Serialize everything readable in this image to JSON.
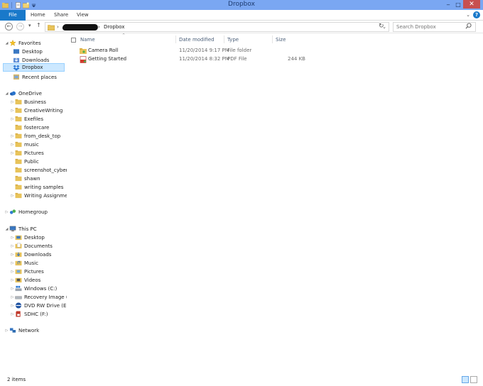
{
  "window": {
    "title": "Dropbox"
  },
  "ribbon": {
    "tabs": [
      "File",
      "Home",
      "Share",
      "View"
    ]
  },
  "address": {
    "current": "Dropbox"
  },
  "search": {
    "placeholder": "Search Dropbox"
  },
  "columns": {
    "name": "Name",
    "date": "Date modified",
    "type": "Type",
    "size": "Size"
  },
  "files": [
    {
      "name": "Camera Roll",
      "date": "11/20/2014 9:17 PM",
      "type": "File folder",
      "size": "",
      "icon": "folder-icon"
    },
    {
      "name": "Getting Started",
      "date": "11/20/2014 8:32 PM",
      "type": "PDF File",
      "size": "244 KB",
      "icon": "pdf-icon"
    }
  ],
  "nav": {
    "favorites": {
      "label": "Favorites",
      "items": [
        "Desktop",
        "Downloads",
        "Dropbox",
        "Recent places"
      ]
    },
    "onedrive": {
      "label": "OneDrive",
      "items": [
        "Business",
        "CreativeWriting",
        "Exefiles",
        "fostercare",
        "from_desk_top",
        "music",
        "Pictures",
        "Public",
        "screenshot_cyberjac",
        "shawn",
        "writing samples",
        "Writing Assignments"
      ]
    },
    "homegroup": {
      "label": "Homegroup"
    },
    "thispc": {
      "label": "This PC",
      "items": [
        "Desktop",
        "Documents",
        "Downloads",
        "Music",
        "Pictures",
        "Videos",
        "Windows (C:)",
        "Recovery Image (D:)",
        "DVD RW Drive (E:) C",
        "SDHC (F:)"
      ]
    },
    "network": {
      "label": "Network"
    }
  },
  "status": {
    "count": "2 items"
  },
  "colors": {
    "titlebar": "#7aa7f2",
    "file_tab": "#1979ca",
    "selected": "#cce8ff",
    "close": "#c75050",
    "folder": "#e8c35a"
  }
}
